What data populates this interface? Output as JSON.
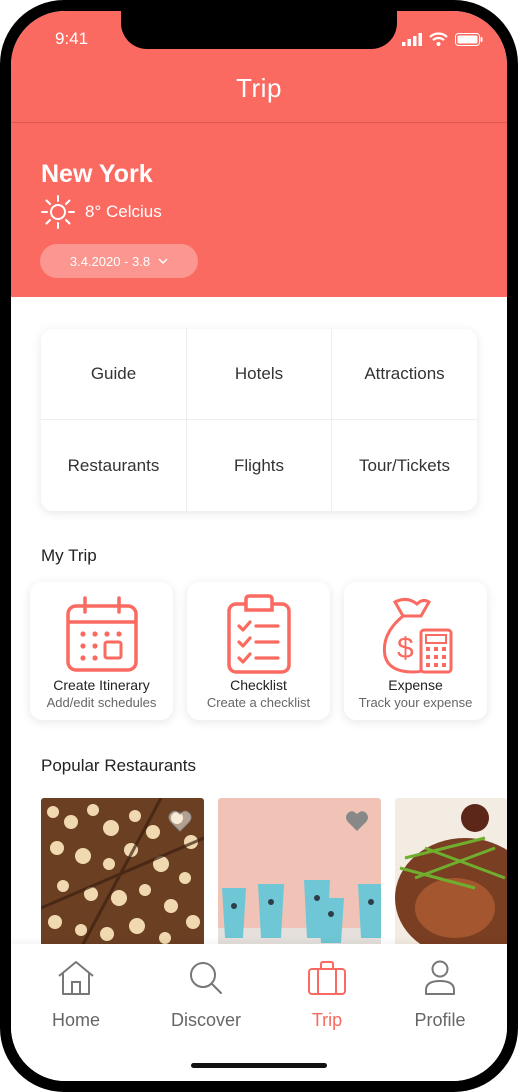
{
  "status": {
    "time": "9:41"
  },
  "nav": {
    "title": "Trip"
  },
  "destination": {
    "city": "New York",
    "weather": "8° Celcius",
    "date_range": "3.4.2020 - 3.8"
  },
  "categories": [
    "Guide",
    "Hotels",
    "Attractions",
    "Restaurants",
    "Flights",
    "Tour/Tickets"
  ],
  "my_trip": {
    "title": "My Trip",
    "cards": [
      {
        "title": "Create Itinerary",
        "subtitle": "Add/edit schedules",
        "icon": "calendar-icon"
      },
      {
        "title": "Checklist",
        "subtitle": "Create a checklist",
        "icon": "clipboard-icon"
      },
      {
        "title": "Expense",
        "subtitle": "Track your expense",
        "icon": "money-bag-calculator-icon"
      }
    ]
  },
  "popular_restaurants": {
    "title": "Popular Restaurants"
  },
  "tabs": [
    {
      "label": "Home",
      "icon": "home-icon",
      "active": false
    },
    {
      "label": "Discover",
      "icon": "search-icon",
      "active": false
    },
    {
      "label": "Trip",
      "icon": "suitcase-icon",
      "active": true
    },
    {
      "label": "Profile",
      "icon": "person-icon",
      "active": false
    }
  ],
  "colors": {
    "accent": "#fa6a61",
    "text": "#222222",
    "muted": "#666666"
  }
}
